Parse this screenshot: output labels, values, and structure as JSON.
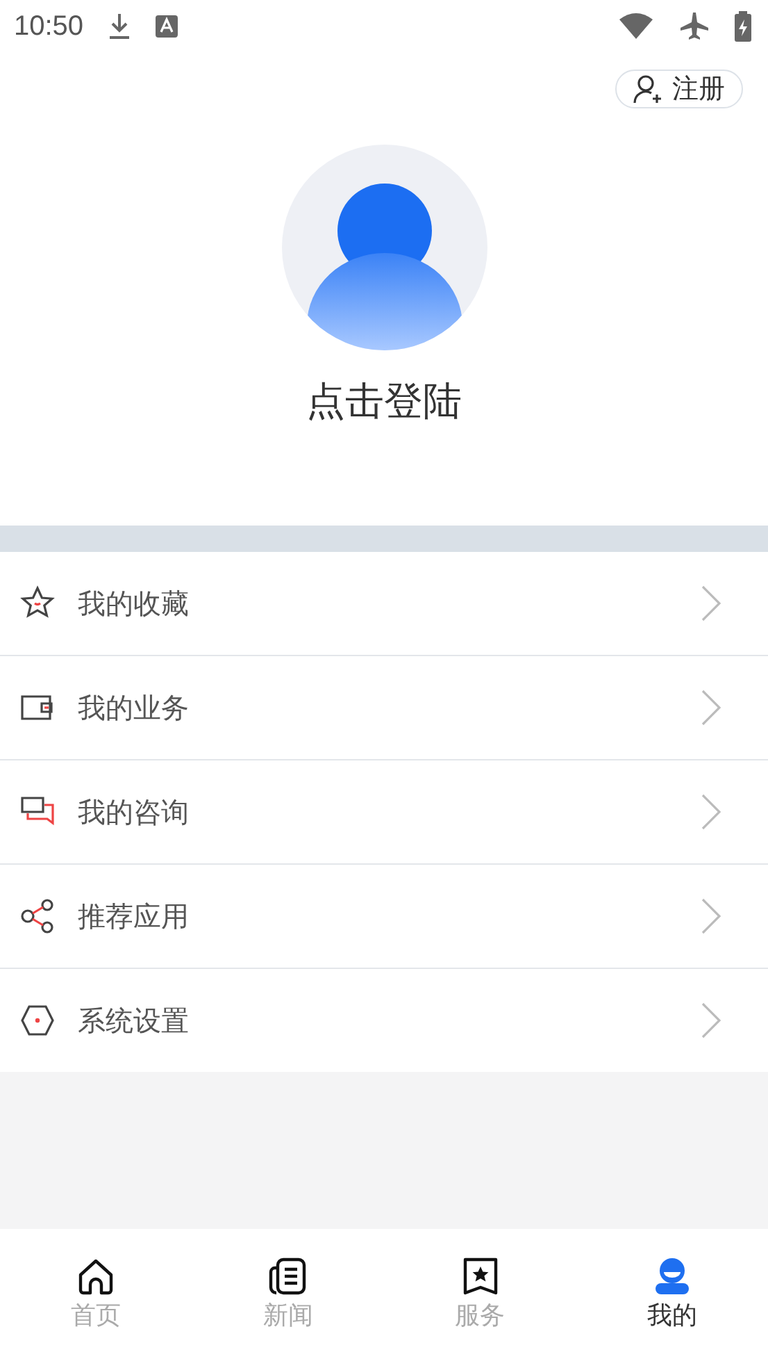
{
  "status_bar": {
    "time": "10:50"
  },
  "register_button": {
    "label": "注册"
  },
  "profile": {
    "login_label": "点击登陆"
  },
  "menu": [
    {
      "kind": "star",
      "label": "我的收藏"
    },
    {
      "kind": "wallet",
      "label": "我的业务"
    },
    {
      "kind": "chat",
      "label": "我的咨询"
    },
    {
      "kind": "share",
      "label": "推荐应用"
    },
    {
      "kind": "settings",
      "label": "系统设置"
    }
  ],
  "tabs": [
    {
      "kind": "home",
      "label": "首页",
      "selected": false
    },
    {
      "kind": "news",
      "label": "新闻",
      "selected": false
    },
    {
      "kind": "service",
      "label": "服务",
      "selected": false
    },
    {
      "kind": "me",
      "label": "我的",
      "selected": true
    }
  ]
}
